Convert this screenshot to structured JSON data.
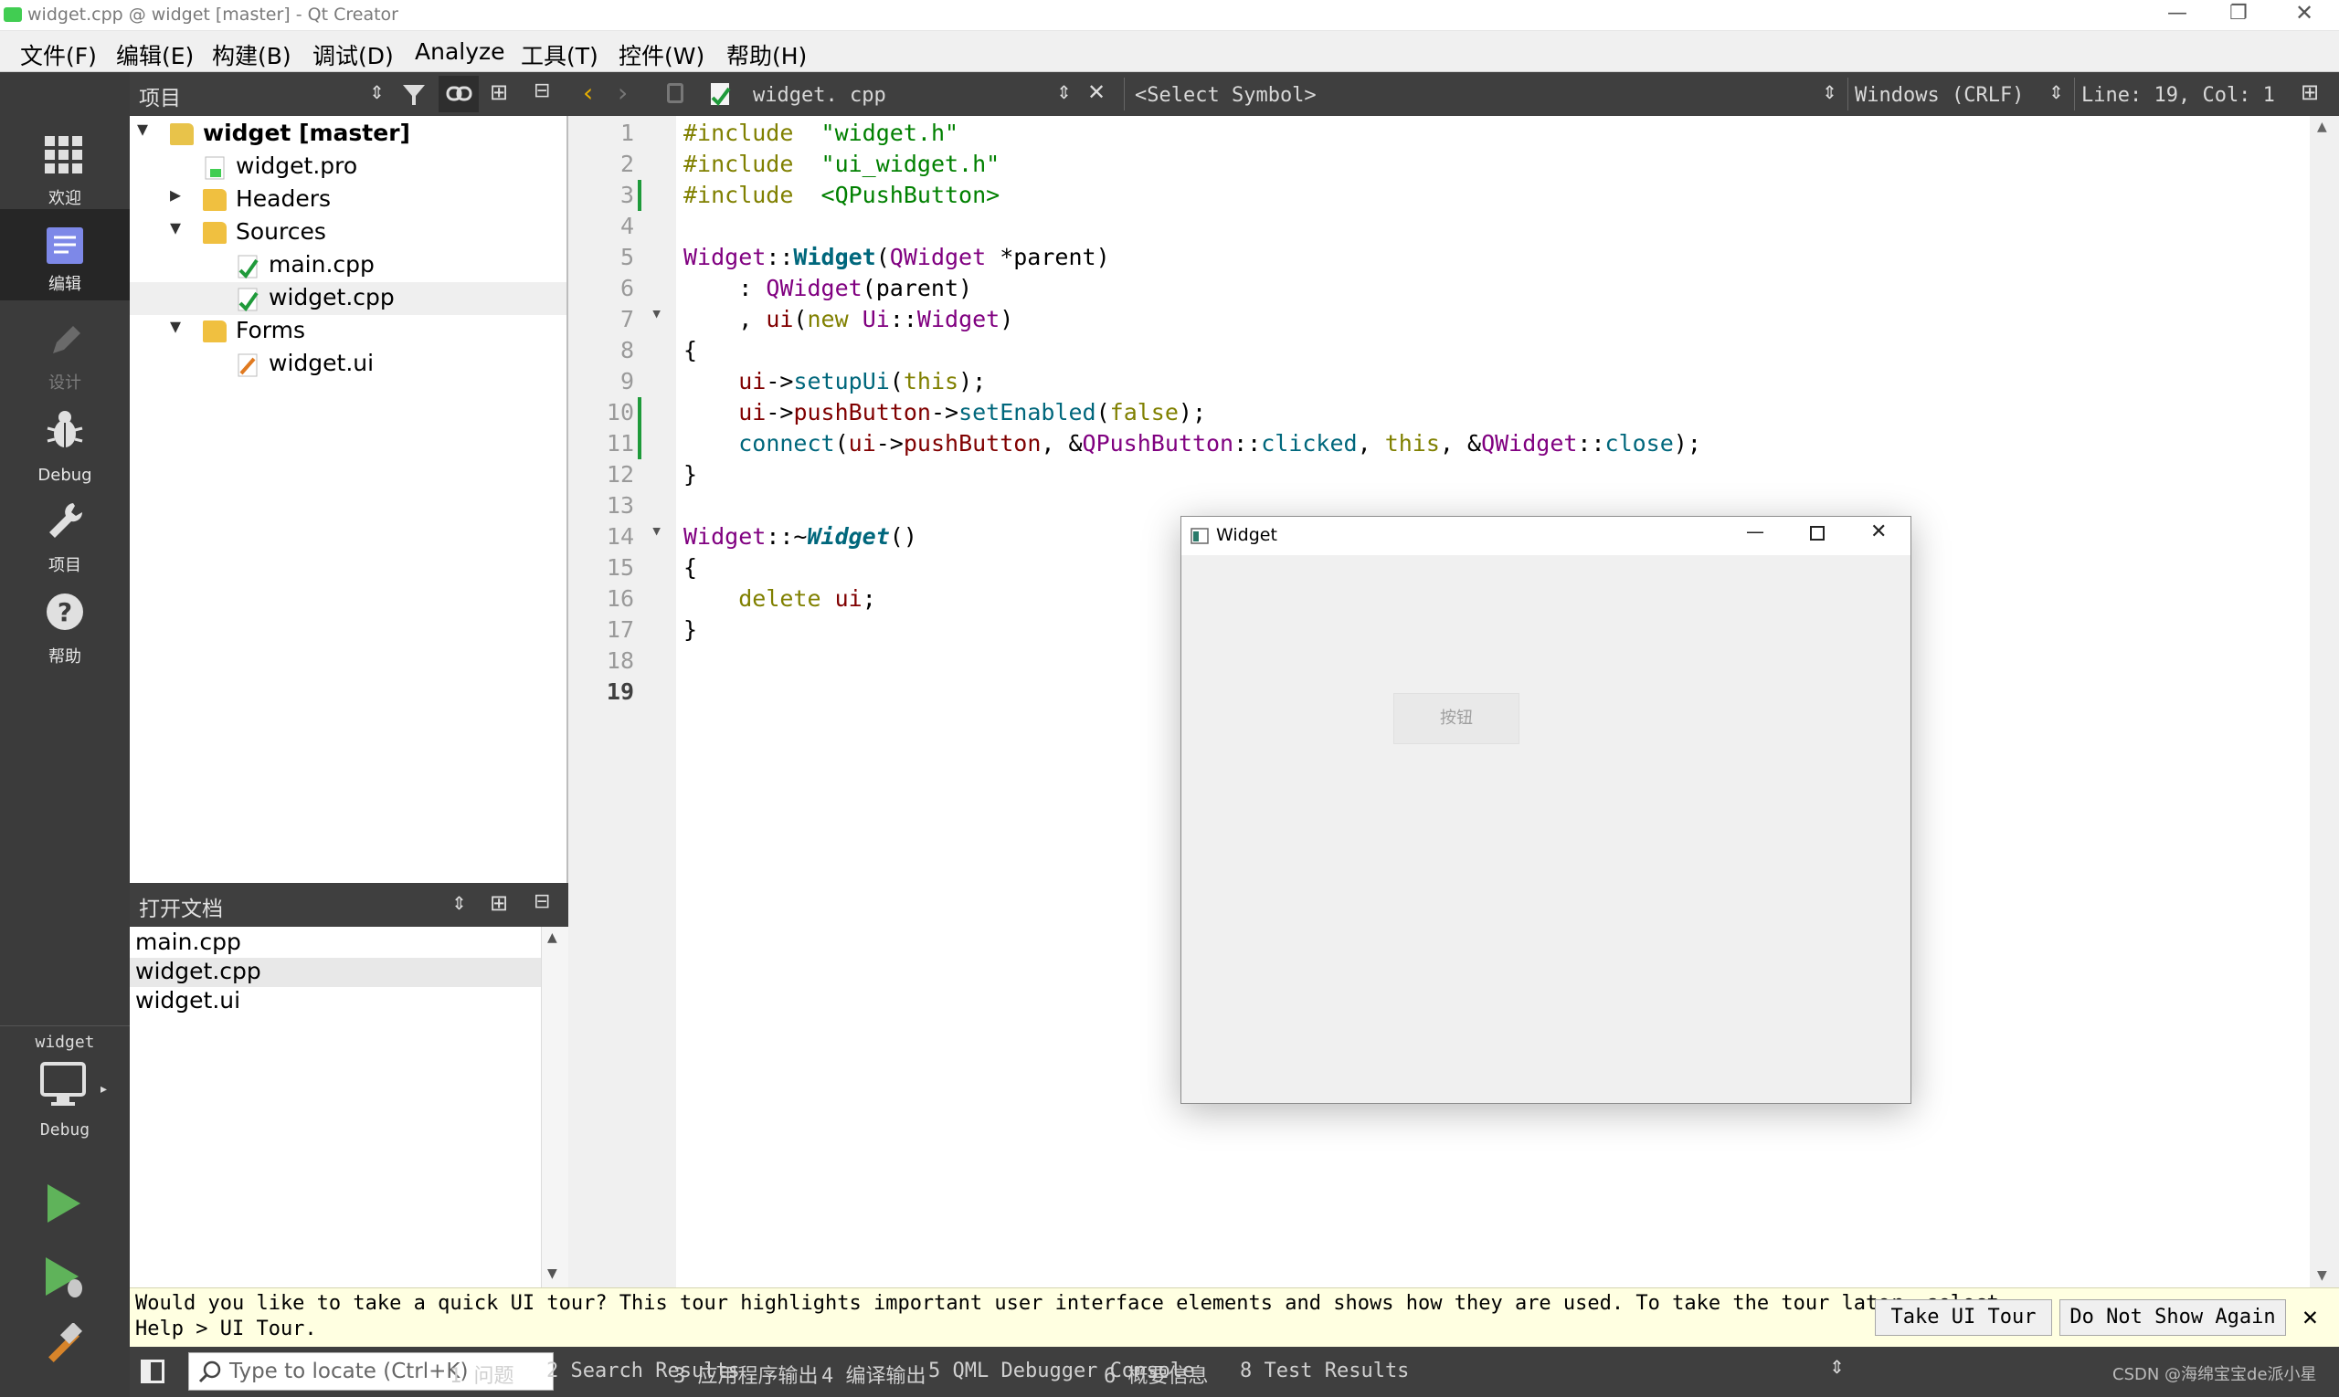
{
  "window": {
    "title": "widget.cpp @ widget [master] - Qt Creator"
  },
  "menu": [
    "文件(F)",
    "编辑(E)",
    "构建(B)",
    "调试(D)",
    "Analyze",
    "工具(T)",
    "控件(W)",
    "帮助(H)"
  ],
  "modes": [
    {
      "label": "欢迎",
      "icon": "grid-icon",
      "active": false
    },
    {
      "label": "编辑",
      "icon": "document-icon",
      "active": true
    },
    {
      "label": "设计",
      "icon": "pencil-icon",
      "active": false
    },
    {
      "label": "Debug",
      "icon": "bug-icon",
      "active": false
    },
    {
      "label": "项目",
      "icon": "wrench-icon",
      "active": false
    },
    {
      "label": "帮助",
      "icon": "help-icon",
      "active": false
    }
  ],
  "kit": {
    "project": "widget",
    "config": "Debug"
  },
  "project_panel": {
    "title": "项目",
    "tree": [
      {
        "label": "widget [master]",
        "level": 0,
        "expander": "open",
        "icon": "project-folder-icon",
        "bold": true
      },
      {
        "label": "widget.pro",
        "level": 1,
        "expander": "",
        "icon": "pro-file-icon"
      },
      {
        "label": "Headers",
        "level": 1,
        "expander": "closed",
        "icon": "headers-folder-icon"
      },
      {
        "label": "Sources",
        "level": 1,
        "expander": "open",
        "icon": "sources-folder-icon"
      },
      {
        "label": "main.cpp",
        "level": 2,
        "expander": "",
        "icon": "cpp-file-icon"
      },
      {
        "label": "widget.cpp",
        "level": 2,
        "expander": "",
        "icon": "cpp-file-icon",
        "selected": true
      },
      {
        "label": "Forms",
        "level": 1,
        "expander": "open",
        "icon": "forms-folder-icon"
      },
      {
        "label": "widget.ui",
        "level": 2,
        "expander": "",
        "icon": "ui-file-icon"
      }
    ]
  },
  "open_docs": {
    "title": "打开文档",
    "items": [
      {
        "label": "main.cpp",
        "selected": false
      },
      {
        "label": "widget.cpp",
        "selected": true
      },
      {
        "label": "widget.ui",
        "selected": false
      }
    ]
  },
  "editor": {
    "file": "widget. cpp",
    "symbol": "<Select Symbol>",
    "line_ending": "Windows (CRLF)",
    "position": "Line: 19, Col: 1",
    "current_line": 19,
    "changed_lines": [
      3,
      10,
      11
    ],
    "fold_lines": [
      7,
      14
    ],
    "lines": [
      [
        [
          "kw",
          "#include"
        ],
        [
          "",
          "  "
        ],
        [
          "str",
          "\"widget.h\""
        ]
      ],
      [
        [
          "kw",
          "#include"
        ],
        [
          "",
          "  "
        ],
        [
          "str",
          "\"ui_widget.h\""
        ]
      ],
      [
        [
          "kw",
          "#include"
        ],
        [
          "",
          "  "
        ],
        [
          "str",
          "<QPushButton>"
        ]
      ],
      [],
      [
        [
          "ty",
          "Widget"
        ],
        [
          "",
          "::"
        ],
        [
          "dn",
          "Widget"
        ],
        [
          "",
          "("
        ],
        [
          "ty",
          "QWidget"
        ],
        [
          "",
          " *parent)"
        ]
      ],
      [
        [
          "",
          "    : "
        ],
        [
          "ty",
          "QWidget"
        ],
        [
          "",
          "(parent)"
        ]
      ],
      [
        [
          "",
          "    , "
        ],
        [
          "mb",
          "ui"
        ],
        [
          "",
          "("
        ],
        [
          "kw",
          "new"
        ],
        [
          "",
          " "
        ],
        [
          "ty",
          "Ui"
        ],
        [
          "",
          "::"
        ],
        [
          "ty",
          "Widget"
        ],
        [
          "",
          ")"
        ]
      ],
      [
        [
          "",
          "{"
        ]
      ],
      [
        [
          "",
          "    "
        ],
        [
          "mb",
          "ui"
        ],
        [
          "",
          "->"
        ],
        [
          "fn",
          "setupUi"
        ],
        [
          "",
          "("
        ],
        [
          "kw",
          "this"
        ],
        [
          "",
          ");"
        ]
      ],
      [
        [
          "",
          "    "
        ],
        [
          "mb",
          "ui"
        ],
        [
          "",
          "->"
        ],
        [
          "mb",
          "pushButton"
        ],
        [
          "",
          "->"
        ],
        [
          "fn",
          "setEnabled"
        ],
        [
          "",
          "("
        ],
        [
          "kw",
          "false"
        ],
        [
          "",
          ");"
        ]
      ],
      [
        [
          "",
          "    "
        ],
        [
          "fn",
          "connect"
        ],
        [
          "",
          "("
        ],
        [
          "mb",
          "ui"
        ],
        [
          "",
          "->"
        ],
        [
          "mb",
          "pushButton"
        ],
        [
          "",
          ", &"
        ],
        [
          "ty",
          "QPushButton"
        ],
        [
          "",
          "::"
        ],
        [
          "fn",
          "clicked"
        ],
        [
          "",
          ", "
        ],
        [
          "kw",
          "this"
        ],
        [
          "",
          ", &"
        ],
        [
          "ty",
          "QWidget"
        ],
        [
          "",
          "::"
        ],
        [
          "fn",
          "close"
        ],
        [
          "",
          ");"
        ]
      ],
      [
        [
          "",
          "}"
        ]
      ],
      [],
      [
        [
          "ty",
          "Widget"
        ],
        [
          "",
          "::~"
        ],
        [
          "it",
          "Widget"
        ],
        [
          "",
          "()"
        ]
      ],
      [
        [
          "",
          "{"
        ]
      ],
      [
        [
          "",
          "    "
        ],
        [
          "kw",
          "delete"
        ],
        [
          "",
          " "
        ],
        [
          "mb",
          "ui"
        ],
        [
          "",
          ";"
        ]
      ],
      [
        [
          "",
          "}"
        ]
      ],
      [],
      []
    ]
  },
  "app_window": {
    "title": "Widget",
    "button_label": "按钮"
  },
  "tour": {
    "line1": "Would you like to take a quick UI tour? This tour highlights important user interface elements and shows how they are used. To take the tour later, select",
    "line2": "Help > UI Tour.",
    "take": "Take UI Tour",
    "dismiss": "Do Not Show Again"
  },
  "status": {
    "locator_placeholder": "Type to locate (Ctrl+K)",
    "panes": [
      "1  问题",
      "2  Search Results",
      "3  应用程序输出",
      "4  编译输出",
      "5  QML Debugger Console",
      "6  概要信息",
      "8  Test Results"
    ],
    "watermark": "CSDN @海绵宝宝de派小星"
  }
}
